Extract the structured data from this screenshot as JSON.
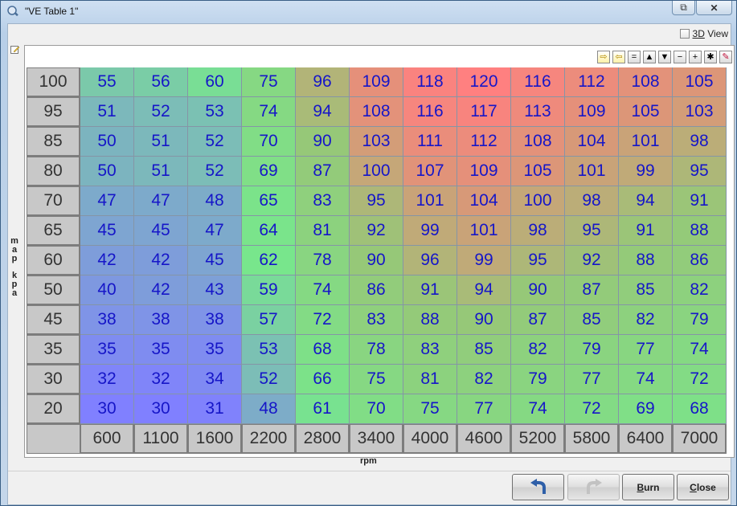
{
  "window": {
    "title": "\"VE Table 1\""
  },
  "view3d": {
    "label": "3D View",
    "checked": false
  },
  "toolbar": {
    "tools": [
      {
        "name": "shift-right-icon",
        "glyph": "⇨"
      },
      {
        "name": "shift-left-icon",
        "glyph": "⇦"
      },
      {
        "name": "equals-icon",
        "glyph": "="
      },
      {
        "name": "increase-icon",
        "glyph": "▲"
      },
      {
        "name": "decrease-icon",
        "glyph": "▼"
      },
      {
        "name": "minus-icon",
        "glyph": "−"
      },
      {
        "name": "plus-icon",
        "glyph": "+"
      },
      {
        "name": "multiply-icon",
        "glyph": "✱"
      },
      {
        "name": "pencil-icon",
        "glyph": "✎"
      }
    ]
  },
  "axes": {
    "y_label": "map kpa",
    "x_label": "rpm"
  },
  "table": {
    "rows": [
      "100",
      "95",
      "85",
      "80",
      "70",
      "65",
      "60",
      "50",
      "45",
      "35",
      "30",
      "20"
    ],
    "cols": [
      "600",
      "1100",
      "1600",
      "2200",
      "2800",
      "3400",
      "4000",
      "4600",
      "5200",
      "5800",
      "6400",
      "7000"
    ],
    "values": [
      [
        55,
        56,
        60,
        75,
        96,
        109,
        118,
        120,
        116,
        112,
        108,
        105
      ],
      [
        51,
        52,
        53,
        74,
        94,
        108,
        116,
        117,
        113,
        109,
        105,
        103
      ],
      [
        50,
        51,
        52,
        70,
        90,
        103,
        111,
        112,
        108,
        104,
        101,
        98
      ],
      [
        50,
        51,
        52,
        69,
        87,
        100,
        107,
        109,
        105,
        101,
        99,
        95
      ],
      [
        47,
        47,
        48,
        65,
        83,
        95,
        101,
        104,
        100,
        98,
        94,
        91
      ],
      [
        45,
        45,
        47,
        64,
        81,
        92,
        99,
        101,
        98,
        95,
        91,
        88
      ],
      [
        42,
        42,
        45,
        62,
        78,
        90,
        96,
        99,
        95,
        92,
        88,
        86
      ],
      [
        40,
        42,
        43,
        59,
        74,
        86,
        91,
        94,
        90,
        87,
        85,
        82
      ],
      [
        38,
        38,
        38,
        57,
        72,
        83,
        88,
        90,
        87,
        85,
        82,
        79
      ],
      [
        35,
        35,
        35,
        53,
        68,
        78,
        83,
        85,
        82,
        79,
        77,
        74
      ],
      [
        32,
        32,
        34,
        52,
        66,
        75,
        81,
        82,
        79,
        77,
        74,
        72
      ],
      [
        30,
        30,
        31,
        48,
        61,
        70,
        75,
        77,
        74,
        72,
        69,
        68
      ]
    ]
  },
  "buttons": {
    "undo": {
      "icon": "undo-icon"
    },
    "redo": {
      "icon": "redo-icon"
    },
    "burn": "Burn",
    "close": "Close"
  }
}
